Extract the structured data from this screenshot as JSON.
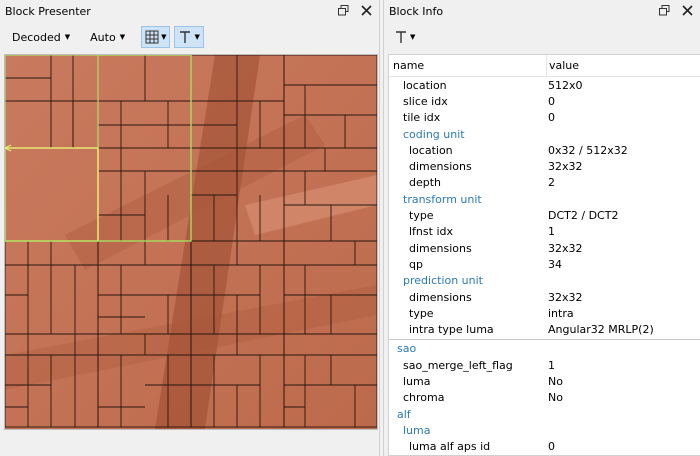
{
  "colors": {
    "accent": "#2a7ab8",
    "block_fill": "#c8755a",
    "highlight": "#a8e060"
  },
  "left_panel": {
    "title": "Block Presenter",
    "toolbar": {
      "mode_value": "Decoded",
      "zoom_value": "Auto"
    }
  },
  "right_panel": {
    "title": "Block Info",
    "tree": {
      "columns": [
        "name",
        "value"
      ],
      "rows": [
        {
          "name": "location",
          "value": "512x0",
          "level": 1,
          "group": false
        },
        {
          "name": "slice idx",
          "value": "0",
          "level": 1,
          "group": false
        },
        {
          "name": "tile idx",
          "value": "0",
          "level": 1,
          "group": false
        },
        {
          "name": "coding unit",
          "value": "",
          "level": 1,
          "group": true
        },
        {
          "name": "location",
          "value": "0x32 / 512x32",
          "level": 2,
          "group": false
        },
        {
          "name": "dimensions",
          "value": "32x32",
          "level": 2,
          "group": false
        },
        {
          "name": "depth",
          "value": "2",
          "level": 2,
          "group": false
        },
        {
          "name": "transform unit",
          "value": "",
          "level": 1,
          "group": true
        },
        {
          "name": "type",
          "value": "DCT2 / DCT2",
          "level": 2,
          "group": false
        },
        {
          "name": "lfnst idx",
          "value": "1",
          "level": 2,
          "group": false
        },
        {
          "name": "dimensions",
          "value": "32x32",
          "level": 2,
          "group": false
        },
        {
          "name": "qp",
          "value": "34",
          "level": 2,
          "group": false
        },
        {
          "name": "prediction unit",
          "value": "",
          "level": 1,
          "group": true
        },
        {
          "name": "dimensions",
          "value": "32x32",
          "level": 2,
          "group": false
        },
        {
          "name": "type",
          "value": "intra",
          "level": 2,
          "group": false
        },
        {
          "name": "intra type luma",
          "value": "Angular32 MRLP(2)",
          "level": 2,
          "group": false
        },
        {
          "name": "sao",
          "value": "",
          "level": 0,
          "group": true,
          "separator_before": true
        },
        {
          "name": "sao_merge_left_flag",
          "value": "1",
          "level": 1,
          "group": false
        },
        {
          "name": "luma",
          "value": "No",
          "level": 1,
          "group": false
        },
        {
          "name": "chroma",
          "value": "No",
          "level": 1,
          "group": false
        },
        {
          "name": "alf",
          "value": "",
          "level": 0,
          "group": true
        },
        {
          "name": "luma",
          "value": "",
          "level": 1,
          "group": true
        },
        {
          "name": "luma alf aps id",
          "value": "0",
          "level": 2,
          "group": false
        }
      ]
    }
  }
}
